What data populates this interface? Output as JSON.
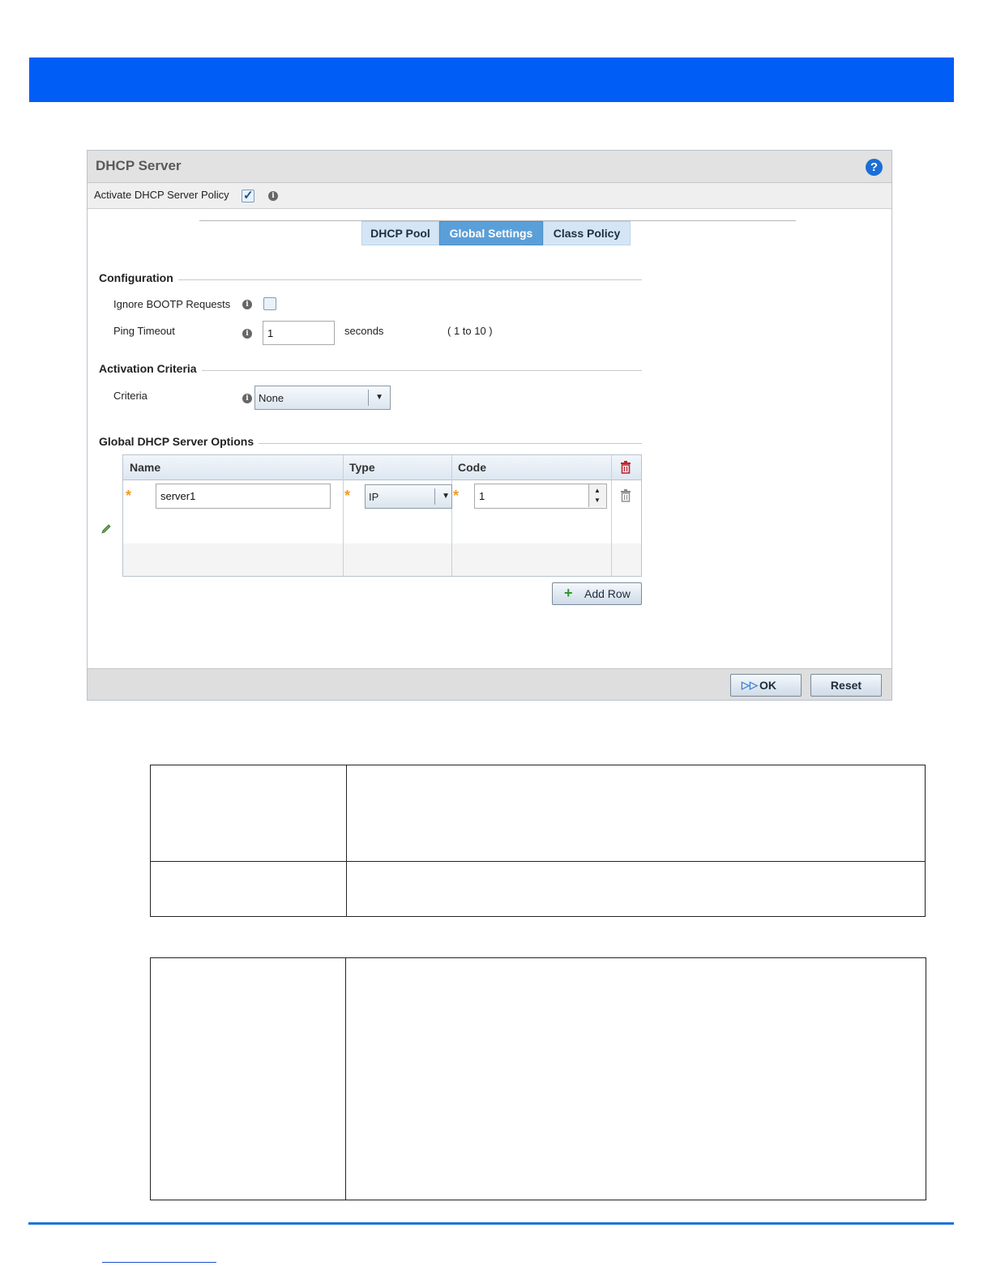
{
  "dialog": {
    "title": "DHCP Server",
    "help_icon": "help-icon",
    "activate_label": "Activate DHCP Server Policy",
    "activate_checked": true
  },
  "tabs": [
    {
      "label": "DHCP Pool",
      "active": false
    },
    {
      "label": "Global Settings",
      "active": true
    },
    {
      "label": "Class Policy",
      "active": false
    }
  ],
  "configuration": {
    "section_title": "Configuration",
    "ignore_bootp_label": "Ignore BOOTP Requests",
    "ignore_bootp_checked": false,
    "ping_timeout_label": "Ping Timeout",
    "ping_timeout_value": "1",
    "ping_timeout_unit": "seconds",
    "ping_timeout_range": "( 1 to 10 )"
  },
  "activation": {
    "section_title": "Activation Criteria",
    "criteria_label": "Criteria",
    "criteria_value": "None"
  },
  "options": {
    "section_title": "Global DHCP Server Options",
    "columns": [
      "Name",
      "Type",
      "Code"
    ],
    "rows": [
      {
        "name": "server1",
        "type": "IP",
        "code": "1"
      }
    ],
    "add_row_label": "Add Row"
  },
  "footer": {
    "ok_label": "OK",
    "reset_label": "Reset"
  },
  "colors": {
    "banner": "#005ef7",
    "active_tab": "#5b9fd8",
    "required_star": "#f39b1e"
  }
}
